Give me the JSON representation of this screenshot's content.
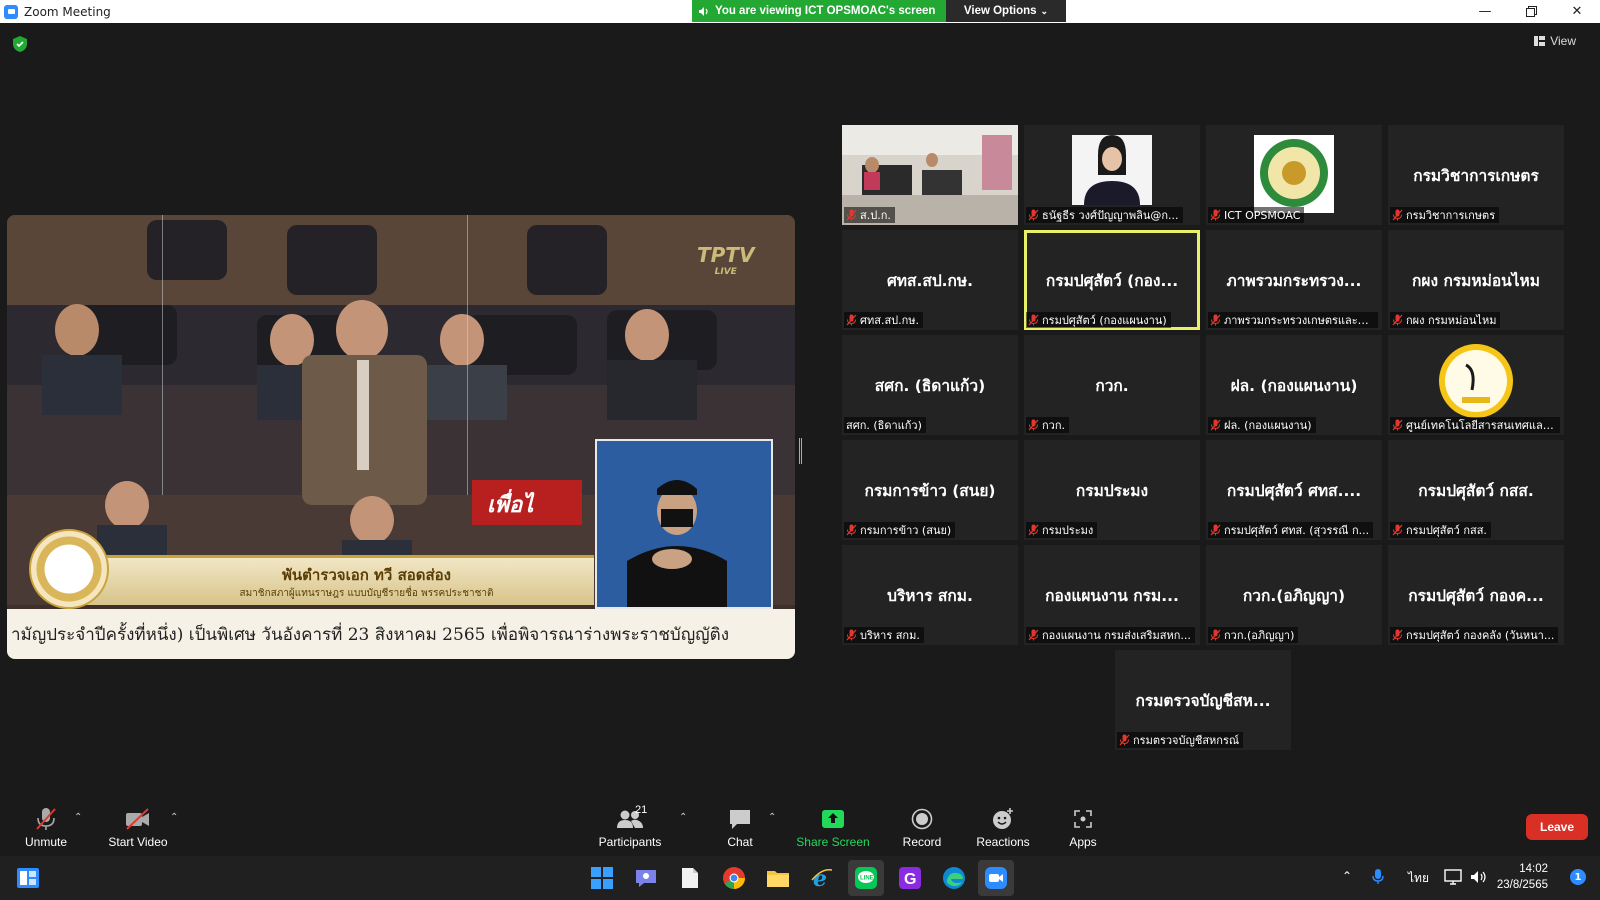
{
  "window": {
    "title": "Zoom Meeting",
    "minimize_icon": "minimize-icon",
    "maximize_icon": "maximize-icon",
    "close_icon": "close-icon"
  },
  "banner": {
    "viewing_text": "You are viewing ICT OPSMOAC's screen",
    "view_options_label": "View Options"
  },
  "meeting": {
    "view_label": "View",
    "shared_content": {
      "speaker_name": "พันตำรวจเอก ทวี สอดส่อง",
      "speaker_position": "สมาชิกสภาผู้แทนราษฎร แบบบัญชีรายชื่อ พรรคประชาชาติ",
      "ticker_text": "ามัญประจำปีครั้งที่หนึ่ง) เป็นพิเศษ วันอังคารที่ 23 สิงหาคม 2565 เพื่อพิจารณาร่างพระราชบัญญัติง",
      "channel_logo": "TPTV",
      "channel_sub": "LIVE",
      "desk_sign": "เพื่อไ"
    }
  },
  "gallery": [
    {
      "type": "video",
      "label": "ส.ป.ก.",
      "muted": true
    },
    {
      "type": "video",
      "label": "ธนัฐธีร วงศ์ปัญญาพลิน@ก...",
      "muted": true
    },
    {
      "type": "logo",
      "label": "ICT OPSMOAC",
      "muted": true
    },
    {
      "type": "name",
      "name": "กรมวิชาการเกษตร",
      "label": "กรมวิชาการเกษตร",
      "muted": true
    },
    {
      "type": "name",
      "name": "ศทส.สป.กษ.",
      "label": "ศทส.สป.กษ.",
      "muted": true
    },
    {
      "type": "name",
      "name": "กรมปศุสัตว์ (กอง...",
      "label": "กรมปศุสัตว์ (กองแผนงาน)",
      "muted": true,
      "active": true
    },
    {
      "type": "name",
      "name": "ภาพรวมกระทรวง...",
      "label": "ภาพรวมกระทรวงเกษตรและส...",
      "muted": true
    },
    {
      "type": "name",
      "name": "กผง กรมหม่อนไหม",
      "label": "กผง กรมหม่อนไหม",
      "muted": true
    },
    {
      "type": "name",
      "name": "สศก. (ธิดาแก้ว)",
      "label": "สศก. (ธิดาแก้ว)",
      "muted": false
    },
    {
      "type": "name",
      "name": "กวก.",
      "label": "กวก.",
      "muted": true
    },
    {
      "type": "name",
      "name": "ฝล. (กองแผนงาน)",
      "label": "ฝล. (กองแผนงาน)",
      "muted": true
    },
    {
      "type": "logo2",
      "label": "ศูนย์เทคโนโลยีสารสนเทศและ...",
      "muted": true
    },
    {
      "type": "name",
      "name": "กรมการข้าว (สนย)",
      "label": "กรมการข้าว (สนย)",
      "muted": true
    },
    {
      "type": "name",
      "name": "กรมประมง",
      "label": "กรมประมง",
      "muted": true
    },
    {
      "type": "name",
      "name": "กรมปศุสัตว์ ศทส....",
      "label": "กรมปศุสัตว์ ศทส. (สุวรรณี ก...",
      "muted": true
    },
    {
      "type": "name",
      "name": "กรมปศุสัตว์ กสส.",
      "label": "กรมปศุสัตว์ กสส.",
      "muted": true
    },
    {
      "type": "name",
      "name": "บริหาร สกม.",
      "label": "บริหาร สกม.",
      "muted": true
    },
    {
      "type": "name",
      "name": "กองแผนงาน กรม...",
      "label": "กองแผนงาน กรมส่งเสริมสหก...",
      "muted": true
    },
    {
      "type": "name",
      "name": "กวก.(อภิญญา)",
      "label": "กวก.(อภิญญา)",
      "muted": true
    },
    {
      "type": "name",
      "name": "กรมปศุสัตว์ กองค...",
      "label": "กรมปศุสัตว์ กองคลัง (วันหนา...",
      "muted": true
    },
    {
      "type": "name",
      "name": "กรมตรวจบัญชีสห...",
      "label": "กรมตรวจบัญชีสหกรณ์",
      "muted": true
    }
  ],
  "toolbar": {
    "unmute_label": "Unmute",
    "start_video_label": "Start Video",
    "participants_label": "Participants",
    "participants_count": "21",
    "chat_label": "Chat",
    "share_screen_label": "Share Screen",
    "record_label": "Record",
    "reactions_label": "Reactions",
    "apps_label": "Apps",
    "leave_label": "Leave",
    "share_color": "#23d959",
    "leave_color": "#d93025"
  },
  "taskbar": {
    "apps": [
      "widgets-icon",
      "windows-start-icon",
      "teams-chat-icon",
      "file-icon",
      "chrome-icon",
      "file-explorer-icon",
      "internet-explorer-icon",
      "line-icon",
      "g-app-icon",
      "edge-icon",
      "zoom-icon"
    ],
    "language": "ไทย",
    "time": "14:02",
    "date": "23/8/2565",
    "notification_count": "1"
  }
}
